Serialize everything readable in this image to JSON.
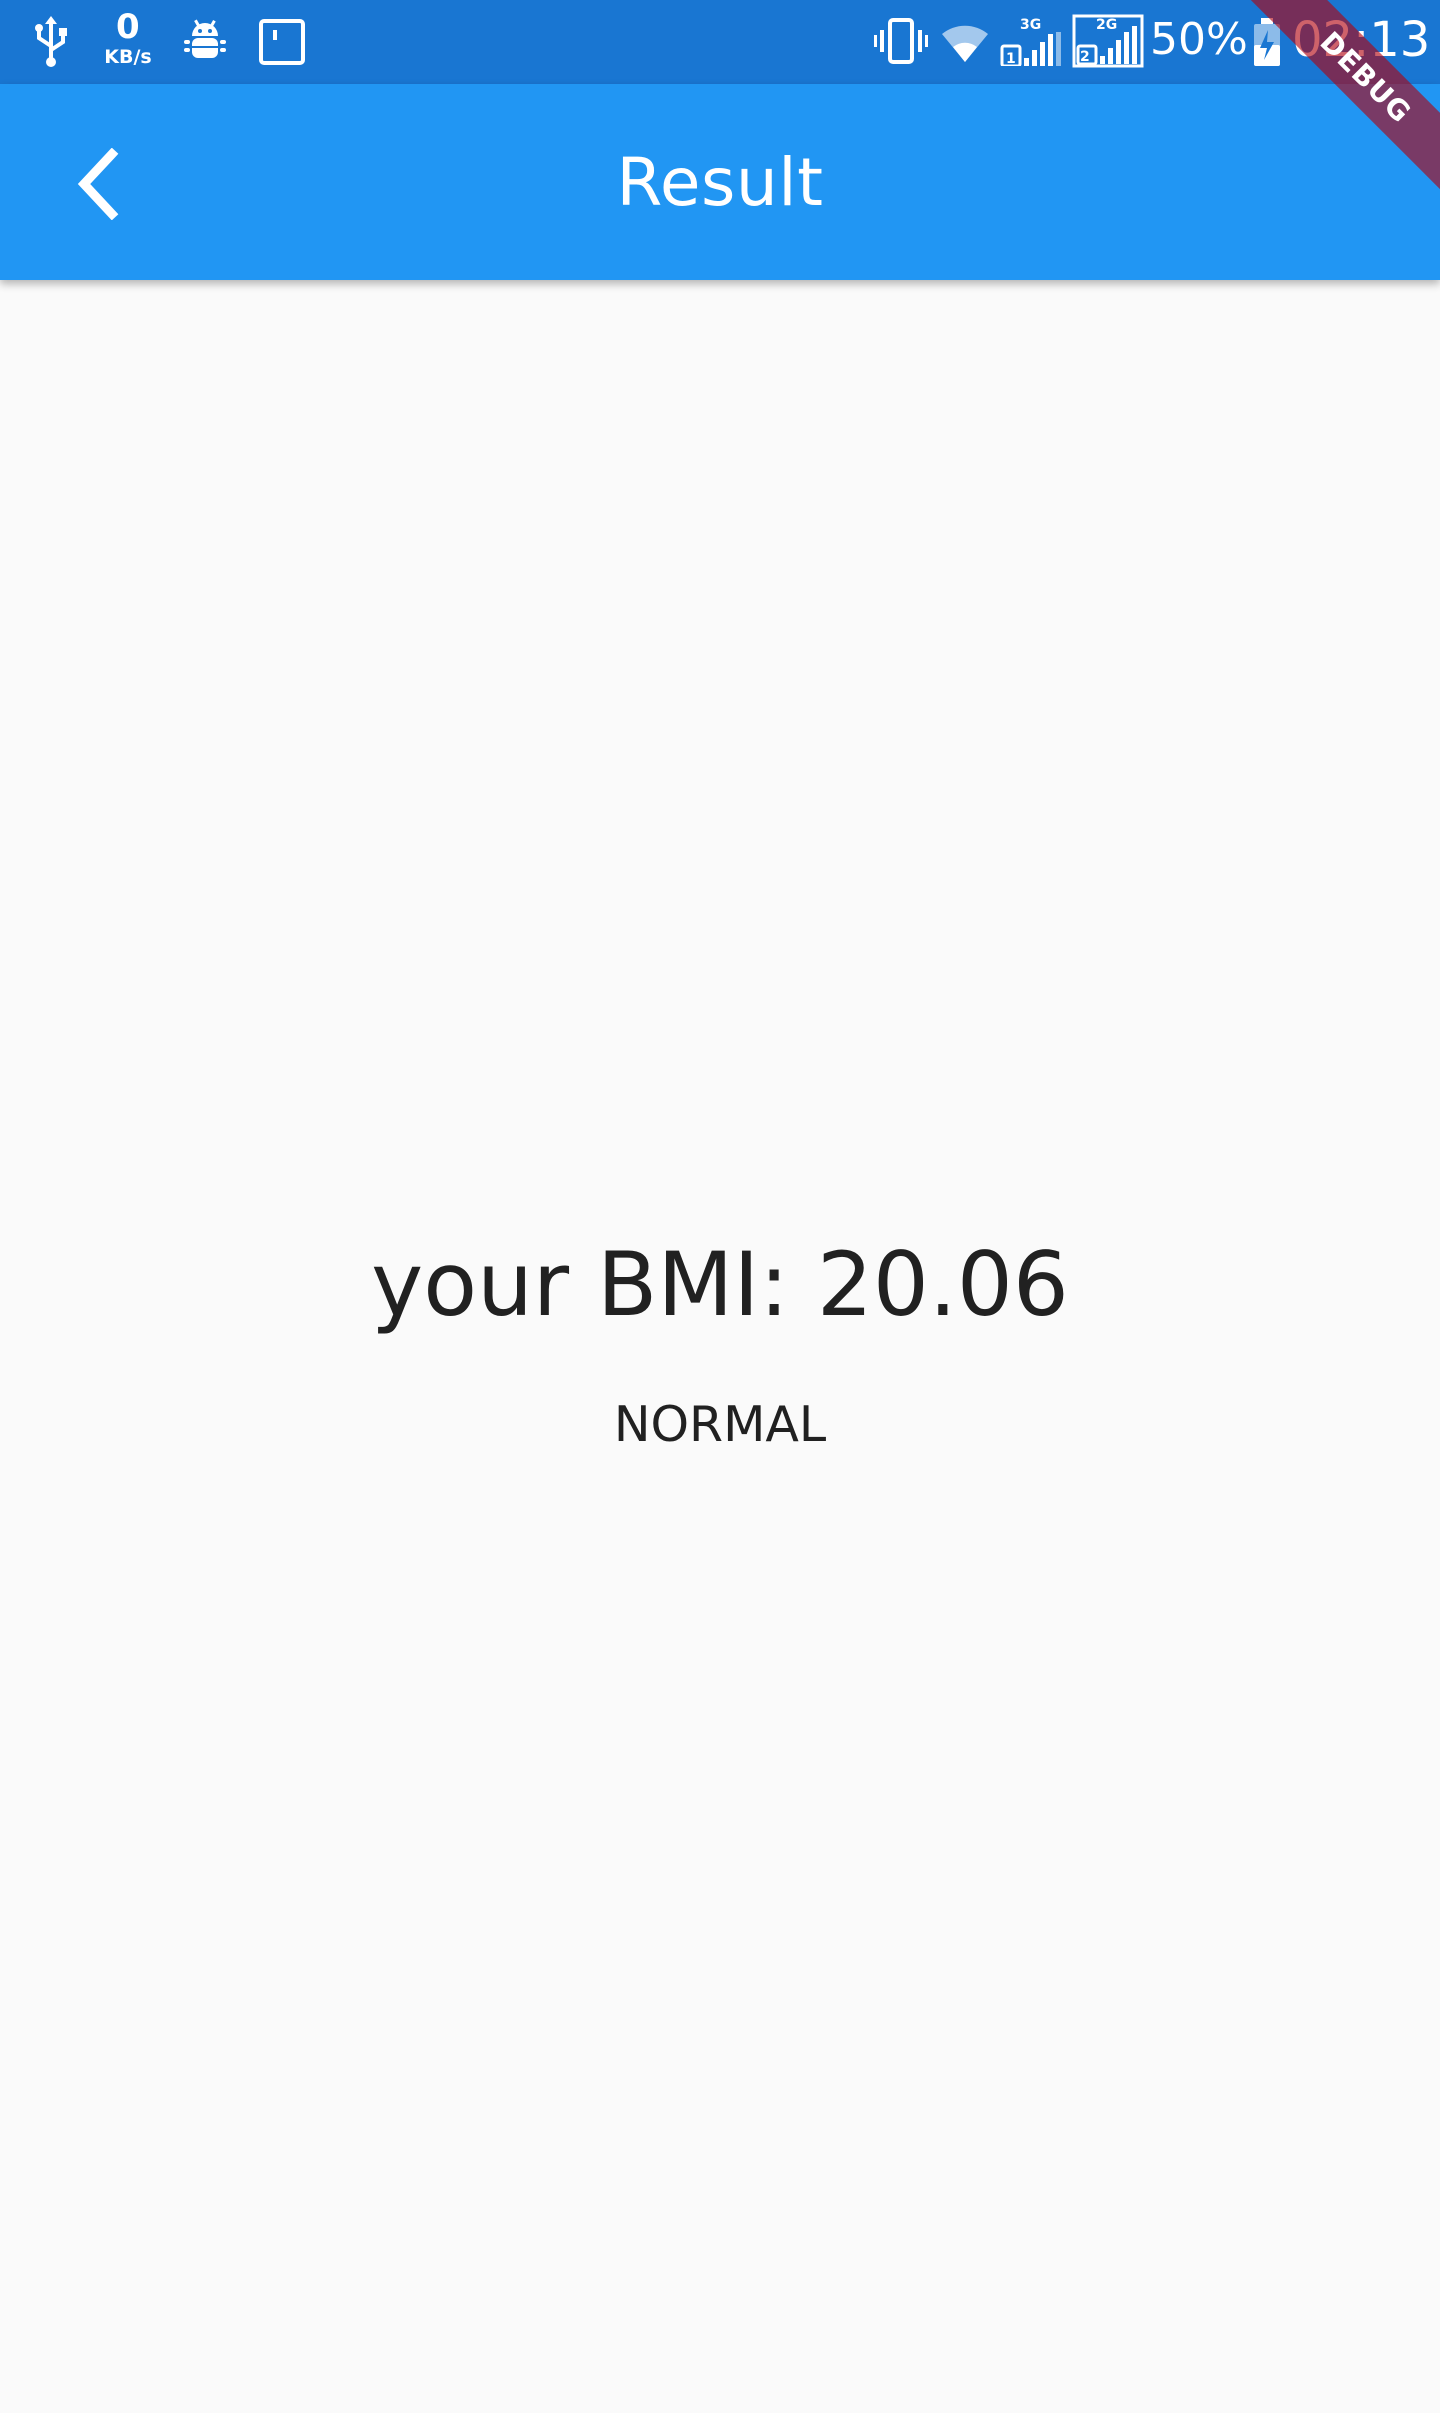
{
  "status_bar": {
    "net_speed_value": "0",
    "net_speed_unit": "KB/s",
    "sim1_label": "3G",
    "sim2_label": "2G",
    "sim1_index": "1",
    "sim2_index": "2",
    "battery_percent": "50%",
    "time": "02:13",
    "icons": [
      "usb-icon",
      "android-debug-icon",
      "screenshot-icon",
      "vibrate-icon",
      "wifi-icon",
      "signal-sim1-icon",
      "signal-sim2-icon",
      "battery-charging-icon"
    ]
  },
  "app_bar": {
    "title": "Result",
    "back_icon": "chevron-left-icon",
    "color": "#2196f3"
  },
  "result": {
    "bmi_text": "your BMI: 20.06",
    "category": "NORMAL"
  },
  "debug_banner": {
    "label": "DEBUG"
  },
  "colors": {
    "status_bar": "#1976d2",
    "app_bar": "#2196f3",
    "background": "#fafafa",
    "text": "#212121"
  }
}
